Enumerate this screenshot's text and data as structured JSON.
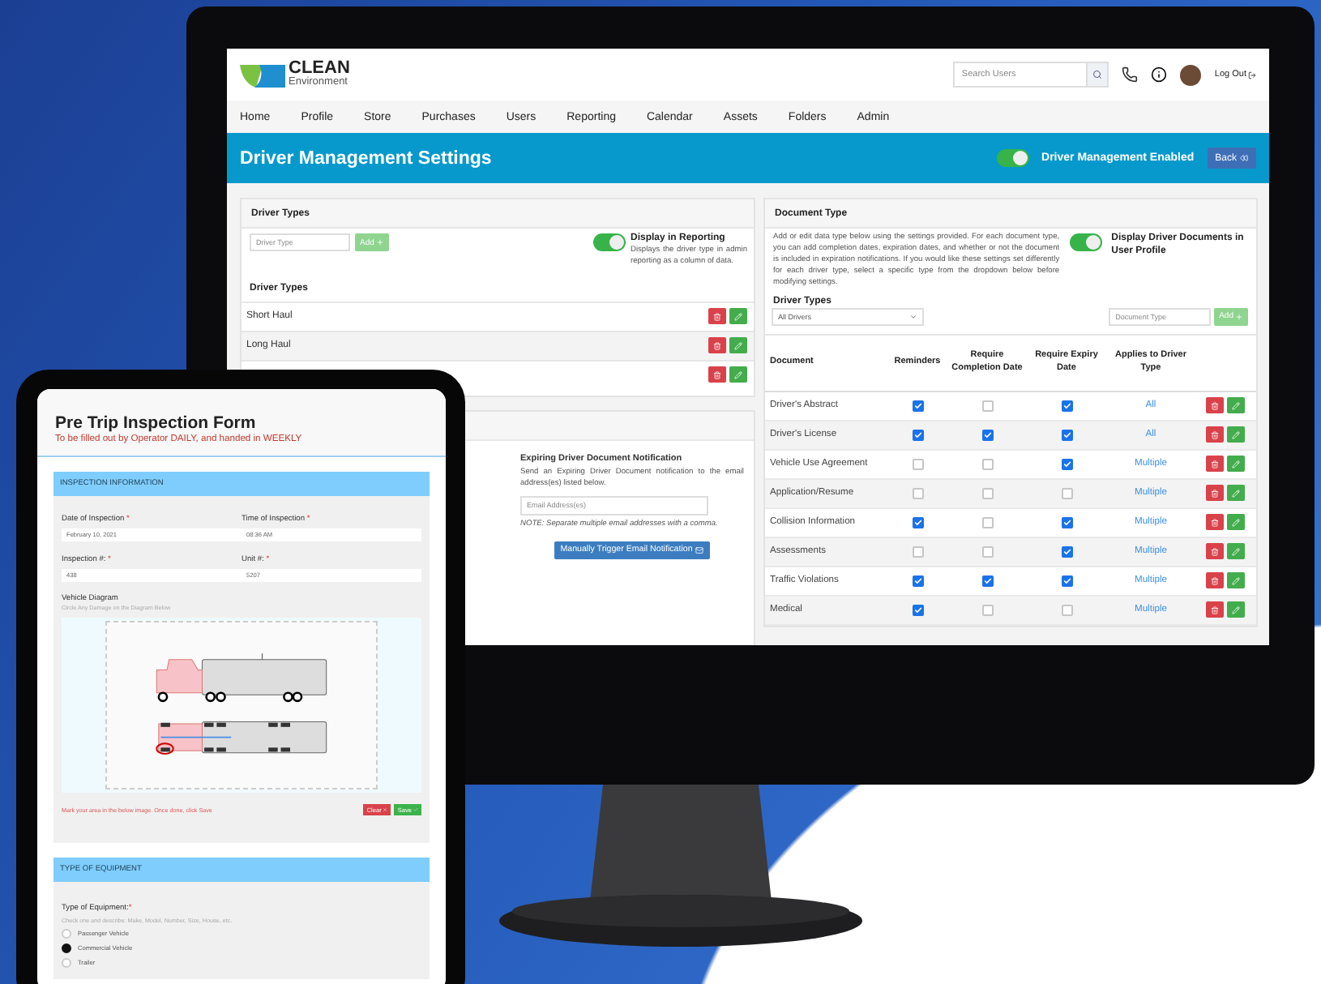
{
  "monitor": {
    "header": {
      "logo": {
        "name": "CLEAN",
        "tagline": "Environment"
      },
      "search": {
        "placeholder": "Search Users"
      },
      "logout": "Log Out"
    },
    "nav": [
      "Home",
      "Profile",
      "Store",
      "Purchases",
      "Users",
      "Reporting",
      "Calendar",
      "Assets",
      "Folders",
      "Admin"
    ],
    "banner": {
      "title": "Driver Management Settings",
      "toggle": {
        "label": "Driver Management Enabled",
        "on": true
      },
      "back": "Back"
    },
    "driver_types_panel": {
      "title": "Driver Types",
      "input": {
        "placeholder": "Driver Type"
      },
      "add": "Add",
      "reporting_toggle": {
        "on": true,
        "label": "Display in Reporting",
        "description": "Displays the driver type in admin reporting as a column of data."
      },
      "list_title": "Driver Types",
      "rows": [
        {
          "name": "Short Haul"
        },
        {
          "name": "Long Haul"
        },
        {}
      ]
    },
    "notification_panel": {
      "title": "Expiring Driver Document Notification",
      "description": "Send an Expiring Driver Document notification to the email address(es) listed below.",
      "email": {
        "placeholder": "Email Address(es)"
      },
      "note": "NOTE: Separate multiple email addresses with a comma.",
      "button": "Manually Trigger Email Notification"
    },
    "document_panel": {
      "title": "Document Type",
      "description": "Add or edit data type below using the settings provided. For each document type, you can add completion dates, expiration dates, and whether or not the document is included in expiration notifications. If you would like these settings set differently for each driver type, select a specific type from the dropdown below before modifying settings.",
      "toggle": {
        "on": true,
        "label": "Display Driver Documents in User Profile"
      },
      "driver_types_label": "Driver Types",
      "select": {
        "value": "All Drivers"
      },
      "input": {
        "placeholder": "Document Type"
      },
      "add": "Add",
      "columns": [
        "Document",
        "Reminders",
        "Require Completion Date",
        "Require Expiry Date",
        "Applies to Driver Type"
      ],
      "rows": [
        {
          "name": "Driver's Abstract",
          "reminders": true,
          "completion": false,
          "expiry": true,
          "applies": "All"
        },
        {
          "name": "Driver's License",
          "reminders": true,
          "completion": true,
          "expiry": true,
          "applies": "All"
        },
        {
          "name": "Vehicle Use Agreement",
          "reminders": false,
          "completion": false,
          "expiry": true,
          "applies": "Multiple"
        },
        {
          "name": "Application/Resume",
          "reminders": false,
          "completion": false,
          "expiry": false,
          "applies": "Multiple"
        },
        {
          "name": "Collision Information",
          "reminders": true,
          "completion": false,
          "expiry": true,
          "applies": "Multiple"
        },
        {
          "name": "Assessments",
          "reminders": false,
          "completion": false,
          "expiry": true,
          "applies": "Multiple"
        },
        {
          "name": "Traffic Violations",
          "reminders": true,
          "completion": true,
          "expiry": true,
          "applies": "Multiple"
        },
        {
          "name": "Medical",
          "reminders": true,
          "completion": false,
          "expiry": false,
          "applies": "Multiple"
        }
      ]
    }
  },
  "tablet": {
    "title": "Pre Trip Inspection Form",
    "subtitle": "To be filled out by Operator DAILY, and handed in WEEKLY",
    "inspection": {
      "title": "INSPECTION INFORMATION",
      "fields": [
        {
          "label": "Date of Inspection",
          "mark": "*",
          "value": "February 10, 2021"
        },
        {
          "label": "Time of Inspection",
          "mark": "*",
          "value": "08:36 AM"
        },
        {
          "label": "Inspection #:",
          "mark": "*",
          "value": "438"
        },
        {
          "label": "Unit #:",
          "mark": "*",
          "value": "5207"
        }
      ],
      "diagram_title": "Vehicle Diagram",
      "diagram_hint": "Circle Any Damage on the Diagram Below",
      "mark_hint": "Mark your area in the below image. Once done, click Save",
      "clear": "Clear",
      "save": "Save"
    },
    "equipment": {
      "title": "TYPE OF EQUIPMENT",
      "label": "Type of Equipment:",
      "mark": "*",
      "hint": "Check one and describe: Make, Model, Number, Size, House, etc.",
      "options": [
        {
          "label": "Passenger Vehicle",
          "selected": false
        },
        {
          "label": "Commercial Vehicle",
          "selected": true
        },
        {
          "label": "Trailer",
          "selected": false
        }
      ]
    }
  }
}
